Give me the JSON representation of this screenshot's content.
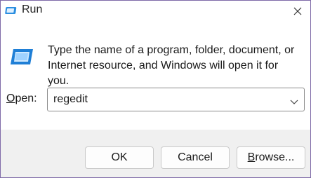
{
  "window": {
    "title": "Run",
    "icon": "run-icon",
    "close_icon": "close-icon"
  },
  "message": "Type the name of a program, folder, document, or Internet resource, and Windows will open it for you.",
  "open_field": {
    "label_accel": "O",
    "label_rest": "pen:",
    "value": "regedit",
    "dropdown_icon": "chevron-down-icon"
  },
  "buttons": {
    "ok": "OK",
    "cancel": "Cancel",
    "browse_accel": "B",
    "browse_rest": "rowse..."
  },
  "colors": {
    "accent": "#1f7fd6",
    "border": "#7f6aa8",
    "footer_bg": "#f0f0f0"
  }
}
